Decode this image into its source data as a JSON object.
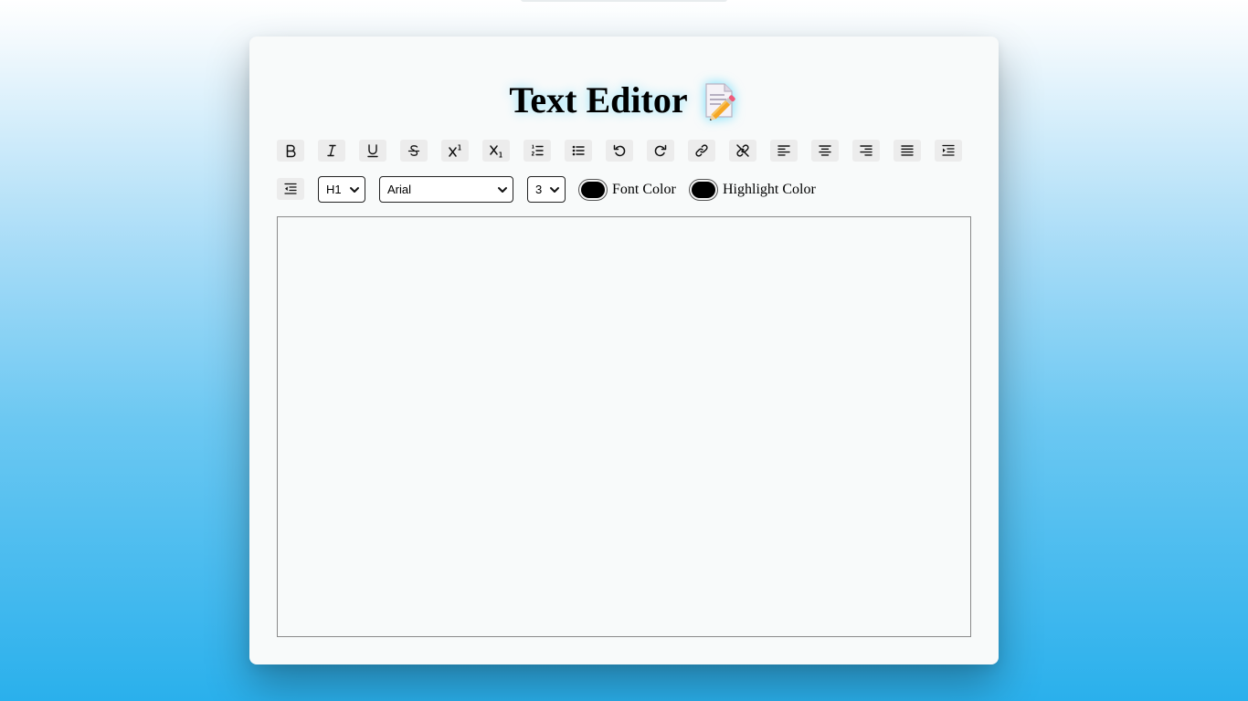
{
  "title": "Text Editor",
  "title_icon": "memo-pencil-icon",
  "toolbar": {
    "buttons": [
      {
        "name": "bold",
        "icon": "bold-icon"
      },
      {
        "name": "italic",
        "icon": "italic-icon"
      },
      {
        "name": "underline",
        "icon": "underline-icon"
      },
      {
        "name": "strikethrough",
        "icon": "strikethrough-icon"
      },
      {
        "name": "superscript",
        "icon": "superscript-icon"
      },
      {
        "name": "subscript",
        "icon": "subscript-icon"
      },
      {
        "name": "ordered-list",
        "icon": "ordered-list-icon"
      },
      {
        "name": "unordered-list",
        "icon": "unordered-list-icon"
      },
      {
        "name": "undo",
        "icon": "undo-icon"
      },
      {
        "name": "redo",
        "icon": "redo-icon"
      },
      {
        "name": "create-link",
        "icon": "link-icon"
      },
      {
        "name": "unlink",
        "icon": "unlink-icon"
      },
      {
        "name": "align-left",
        "icon": "align-left-icon"
      },
      {
        "name": "align-center",
        "icon": "align-center-icon"
      },
      {
        "name": "align-right",
        "icon": "align-right-icon"
      },
      {
        "name": "align-justify",
        "icon": "align-justify-icon"
      },
      {
        "name": "indent",
        "icon": "indent-icon"
      },
      {
        "name": "outdent",
        "icon": "outdent-icon"
      }
    ],
    "heading_select": {
      "value": "H1"
    },
    "font_select": {
      "value": "Arial"
    },
    "size_select": {
      "value": "3"
    },
    "font_color": {
      "label": "Font Color",
      "value": "#000000"
    },
    "highlight_color": {
      "label": "Highlight Color",
      "value": "#000000"
    }
  },
  "editor": {
    "content": ""
  },
  "colors": {
    "card_background": "#f8fafa",
    "button_background": "#ececec",
    "gradient_bottom": "#2ab0ec"
  }
}
